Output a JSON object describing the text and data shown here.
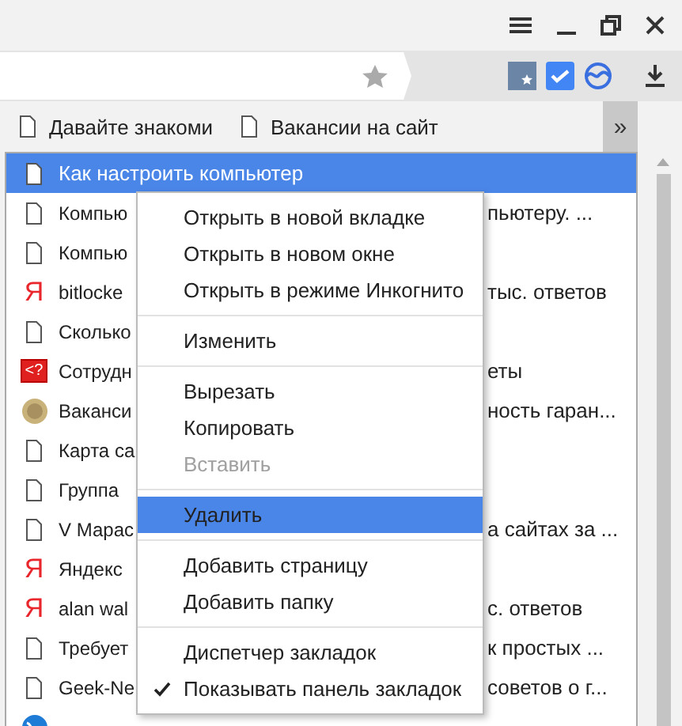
{
  "bookmarks_bar": {
    "items": [
      {
        "label": "Давайте знакоми"
      },
      {
        "label": "Вакансии на сайт"
      }
    ],
    "overflow_button": "»"
  },
  "bookmarks_dropdown": {
    "items": [
      {
        "kind": "page",
        "text": "Как настроить компьютер",
        "selected": true
      },
      {
        "kind": "page",
        "text": "Компью",
        "text_right": "пьютеру. ...",
        "selected": false
      },
      {
        "kind": "page",
        "text": "Компью",
        "selected": false
      },
      {
        "kind": "letter",
        "mark": "Я",
        "text": "bitlocke",
        "text_right": "тыс. ответов",
        "selected": false
      },
      {
        "kind": "page",
        "text": "Сколько",
        "selected": false
      },
      {
        "kind": "badge",
        "mark": "<?",
        "text": "Сотрудн",
        "text_right": "еты",
        "selected": false
      },
      {
        "kind": "coin",
        "text": "Ваканси",
        "text_right": "ность гаран...",
        "selected": false
      },
      {
        "kind": "page",
        "text": "Карта са",
        "selected": false
      },
      {
        "kind": "page",
        "text": "Группа",
        "selected": false
      },
      {
        "kind": "page",
        "text": "V Марас",
        "text_right": "а сайтах за ...",
        "selected": false
      },
      {
        "kind": "letter",
        "mark": "Я",
        "text": "Яндекс",
        "selected": false
      },
      {
        "kind": "letter",
        "mark": "Я",
        "text": "alan wal",
        "text_right": "с. ответов",
        "selected": false
      },
      {
        "kind": "page",
        "text": "Требует",
        "text_right": "к простых ...",
        "selected": false
      },
      {
        "kind": "page",
        "text": "Geek-Ne",
        "text_right": "советов о г...",
        "selected": false
      },
      {
        "kind": "globe",
        "selected": false
      }
    ]
  },
  "context_menu": {
    "items": [
      {
        "kind": "item",
        "label": "Открыть в новой вкладке",
        "disabled": false,
        "selected": false,
        "checked": false
      },
      {
        "kind": "item",
        "label": "Открыть в новом окне",
        "disabled": false,
        "selected": false,
        "checked": false
      },
      {
        "kind": "item",
        "label": "Открыть в режиме Инкогнито",
        "disabled": false,
        "selected": false,
        "checked": false
      },
      {
        "kind": "divider"
      },
      {
        "kind": "item",
        "label": "Изменить",
        "disabled": false,
        "selected": false,
        "checked": false
      },
      {
        "kind": "divider"
      },
      {
        "kind": "item",
        "label": "Вырезать",
        "disabled": false,
        "selected": false,
        "checked": false
      },
      {
        "kind": "item",
        "label": "Копировать",
        "disabled": false,
        "selected": false,
        "checked": false
      },
      {
        "kind": "item",
        "label": "Вставить",
        "disabled": true,
        "selected": false,
        "checked": false
      },
      {
        "kind": "divider"
      },
      {
        "kind": "item",
        "label": "Удалить",
        "disabled": false,
        "selected": true,
        "checked": false
      },
      {
        "kind": "divider"
      },
      {
        "kind": "item",
        "label": "Добавить страницу",
        "disabled": false,
        "selected": false,
        "checked": false
      },
      {
        "kind": "item",
        "label": "Добавить папку",
        "disabled": false,
        "selected": false,
        "checked": false
      },
      {
        "kind": "divider"
      },
      {
        "kind": "item",
        "label": "Диспетчер закладок",
        "disabled": false,
        "selected": false,
        "checked": false
      },
      {
        "kind": "item",
        "label": "Показывать панель закладок",
        "disabled": false,
        "selected": false,
        "checked": true
      }
    ]
  }
}
